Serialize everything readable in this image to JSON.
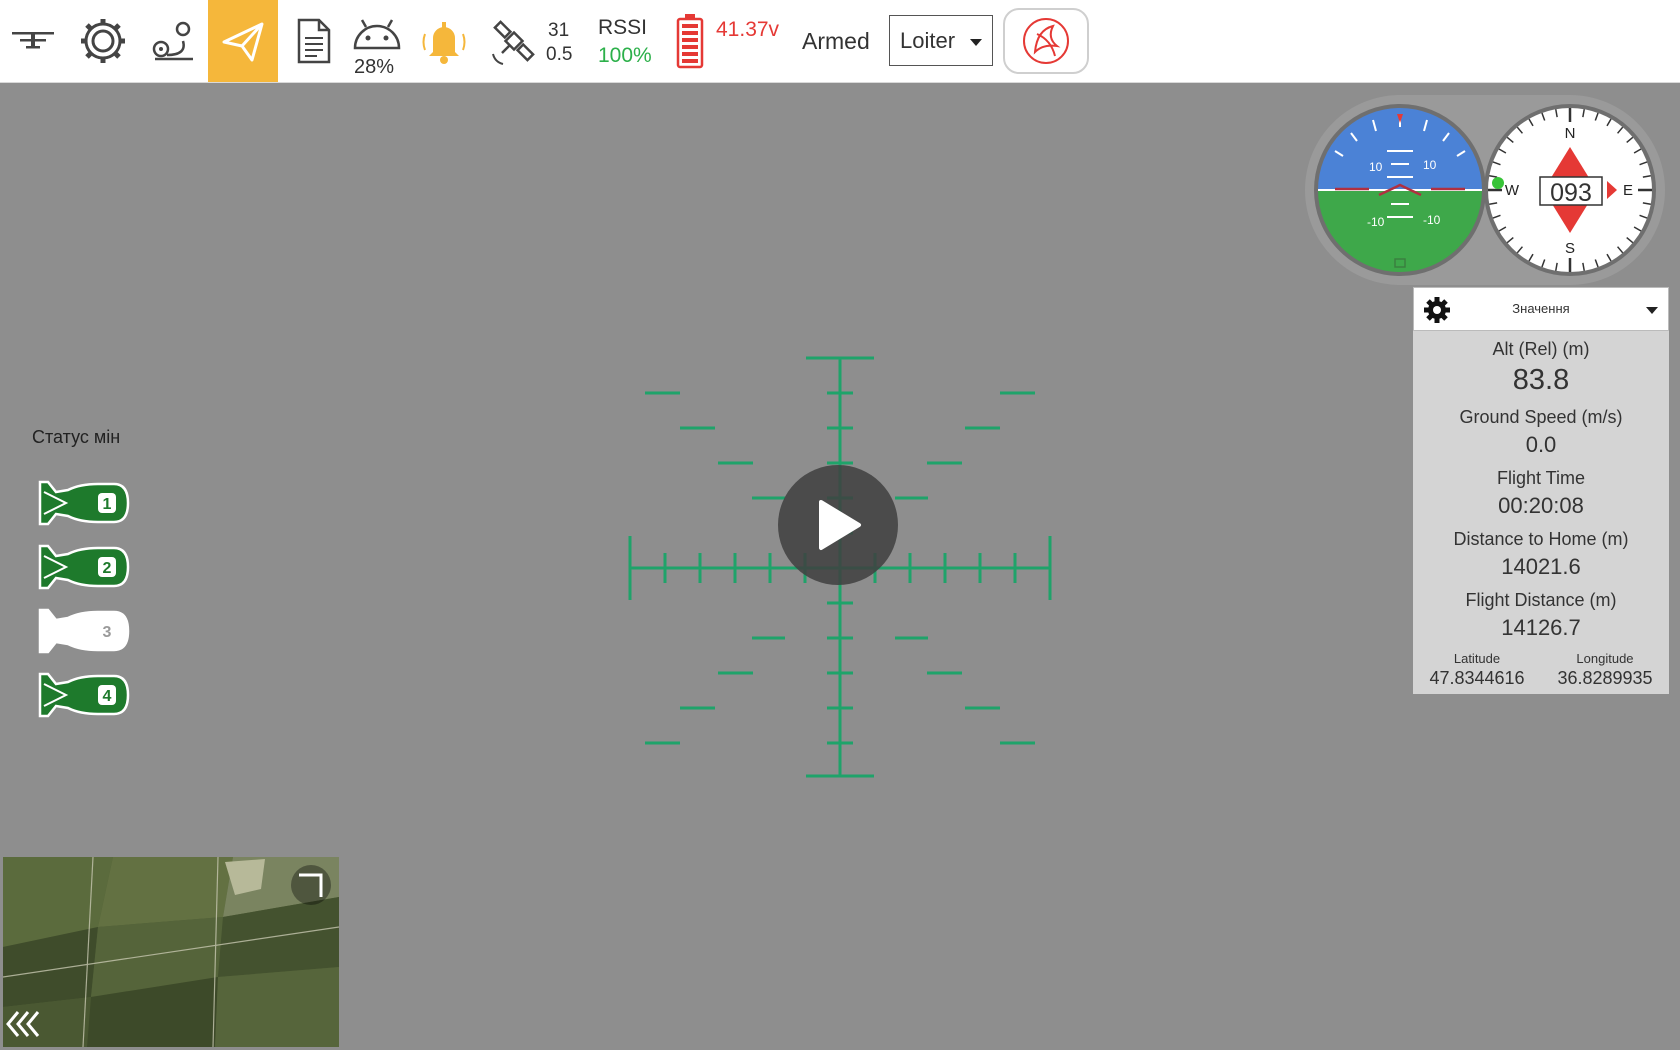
{
  "toolbar": {
    "menu_icon": "drone-menu-icon",
    "settings_icon": "gear-icon",
    "plan_icon": "route-plan-icon",
    "fly_icon": "paper-plane-icon",
    "log_icon": "document-icon",
    "device_battery": "28%",
    "alert_icon": "bell-icon",
    "satellite_count": "31",
    "hdop": "0.5",
    "rssi_label": "RSSI",
    "rssi_value": "100%",
    "battery_voltage": "41.37v",
    "armed_status": "Armed",
    "flight_mode": "Loiter",
    "colors": {
      "active_tab": "#f5b73b",
      "good": "#2cb04a",
      "warning": "#e53935"
    }
  },
  "mines": {
    "title": "Статус мін",
    "items": [
      {
        "number": "1",
        "state": "loaded",
        "color": "#1e7a2c"
      },
      {
        "number": "2",
        "state": "loaded",
        "color": "#1e7a2c"
      },
      {
        "number": "3",
        "state": "released",
        "color": "#ffffff"
      },
      {
        "number": "4",
        "state": "loaded",
        "color": "#1e7a2c"
      }
    ]
  },
  "attitude_indicator": {
    "pitch_labels": [
      "10",
      "10",
      "-10",
      "-10"
    ]
  },
  "compass": {
    "heading": "093",
    "north": "N",
    "east": "E",
    "south": "S",
    "west": "W"
  },
  "telemetry": {
    "selector_label": "Значення",
    "alt_label": "Alt (Rel) (m)",
    "alt_value": "83.8",
    "speed_label": "Ground Speed (m/s)",
    "speed_value": "0.0",
    "time_label": "Flight Time",
    "time_value": "00:20:08",
    "home_label": "Distance to Home (m)",
    "home_value": "14021.6",
    "dist_label": "Flight Distance (m)",
    "dist_value": "14126.7",
    "lat_label": "Latitude",
    "lat_value": "47.8344616",
    "lon_label": "Longitude",
    "lon_value": "36.8289935"
  },
  "video": {
    "play_icon": "play-icon",
    "reticle_color": "#1fa36a"
  }
}
